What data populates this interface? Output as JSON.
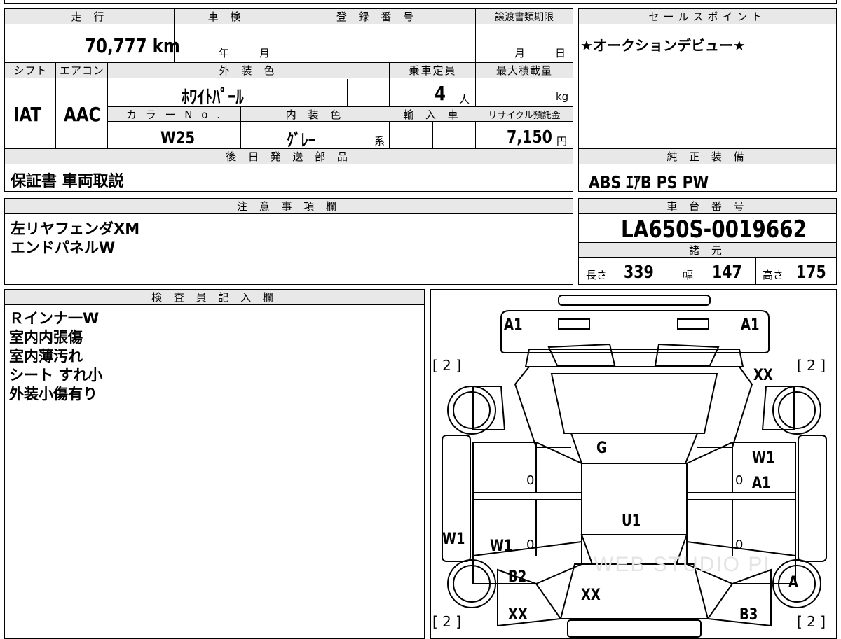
{
  "headers": {
    "mileage": "走 行",
    "inspection": "車 検",
    "registration": "登 録 番 号",
    "transfer_deadline": "譲渡書類期限",
    "sales_point": "セールスポイント",
    "shift": "シフト",
    "aircon": "エアコン",
    "exterior_color": "外 装 色",
    "capacity": "乗車定員",
    "max_load": "最大積載量",
    "color_no": "カ ラ ー N o .",
    "interior_color": "内 装 色",
    "import": "輸 入 車",
    "recycle_fee": "リサイクル預託金",
    "later_parts": "後 日 発 送 部 品",
    "genuine_equipment": "純 正 装 備",
    "caution": "注 意 事 項 欄",
    "chassis_no": "車 台 番 号",
    "specs": "諸 元",
    "inspector": "検 査 員 記 入 欄"
  },
  "vehicle": {
    "mileage": "70,777 km",
    "inspection_year_unit": "年",
    "inspection_month_unit": "月",
    "deadline_month_unit": "月",
    "deadline_day_unit": "日",
    "shift": "IAT",
    "aircon": "AAC",
    "exterior_color": "ﾎﾜｲﾄﾊﾟｰﾙ",
    "capacity": "4",
    "capacity_unit": "人",
    "max_load_unit": "kg",
    "color_no": "W25",
    "interior_color": "ｸﾞﾚｰ",
    "interior_suffix": "系",
    "recycle_fee": "7,150",
    "recycle_unit": "円",
    "chassis_no": "LA650S-0019662",
    "length_label": "長さ",
    "length": "339",
    "width_label": "幅",
    "width": "147",
    "height_label": "高さ",
    "height": "175"
  },
  "sales_point_text": "★オークションデビュー★",
  "later_parts_text": "保証書 車両取説",
  "genuine_equipment_text": "ABS ｴｱB PS PW",
  "caution_lines": [
    "左リヤフェンダXM",
    "エンドパネルW"
  ],
  "inspector_lines": [
    "Ｒインナ一W",
    "室内内張傷",
    "室内薄汚れ",
    "シート すれ小",
    "外装小傷有り"
  ],
  "diagram": {
    "labels": {
      "a1_left": "A1",
      "a1_right": "A1",
      "tire_fl": "[ 2 ]",
      "tire_fr": "[ 2 ]",
      "tire_rl": "[ 2 ]",
      "tire_rr": "[ 2 ]",
      "xx_front_right": "XX",
      "g": "G",
      "w1_right_top": "W1",
      "a1_right_door": "A1",
      "u1": "U1",
      "w1_left_side": "W1",
      "w1_left_door": "W1",
      "b2": "B2",
      "xx_rear_center": "XX",
      "xx_rear_left": "XX",
      "a_rear_right": "A",
      "b3": "B3",
      "zero_1": "0",
      "zero_2": "0",
      "zero_3": "0",
      "zero_4": "0"
    },
    "watermark": "WEB STUDIO PI"
  }
}
